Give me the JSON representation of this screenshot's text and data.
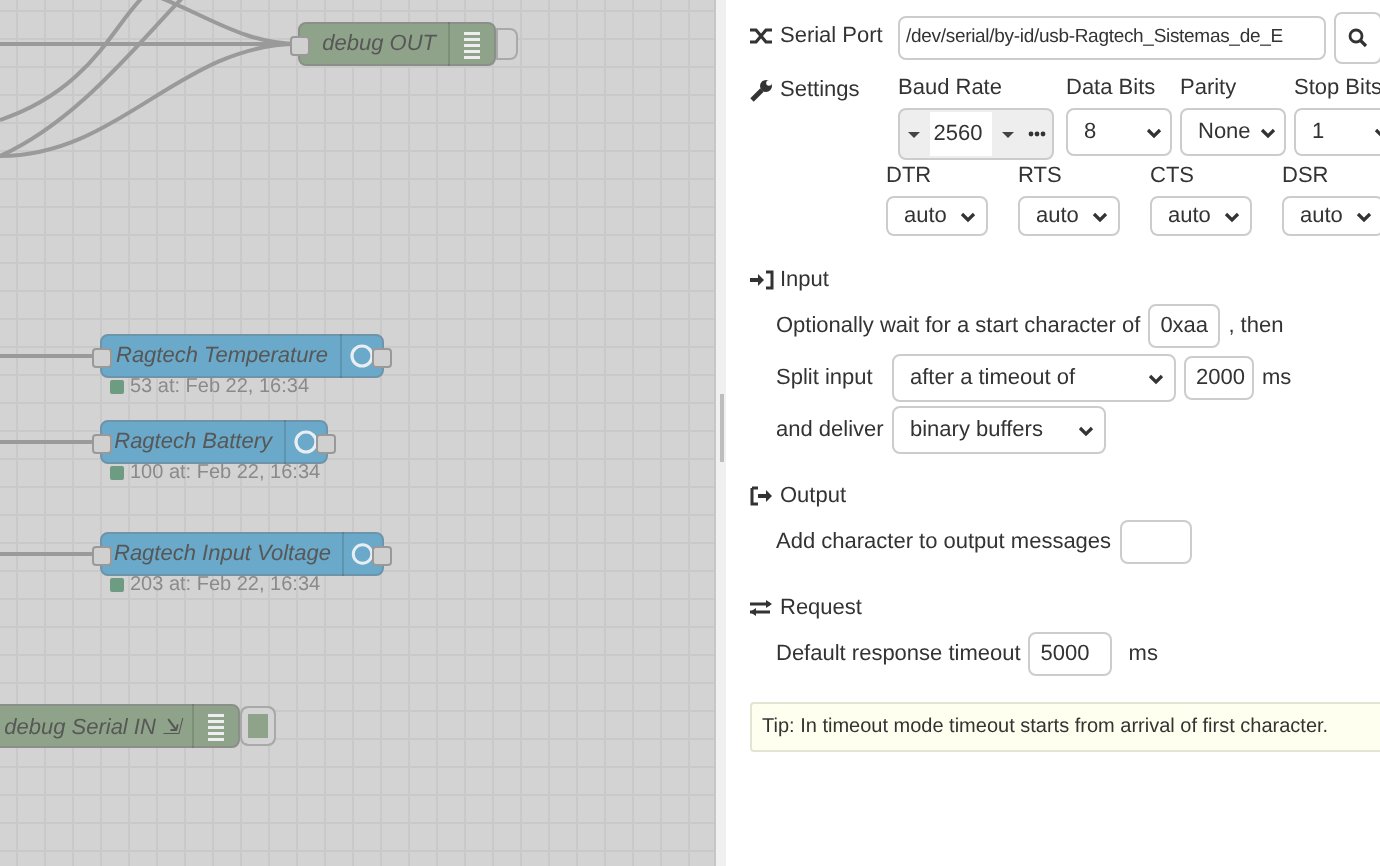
{
  "canvas": {
    "nodes": [
      {
        "kind": "debug",
        "label": "debug OUT",
        "active": false
      },
      {
        "kind": "function",
        "label": "Ragtech Temperature",
        "status": "53 at: Feb 22, 16:34"
      },
      {
        "kind": "function",
        "label": "Ragtech Battery",
        "status": "100 at: Feb 22, 16:34"
      },
      {
        "kind": "function",
        "label": "Ragtech Input Voltage",
        "status": "203 at: Feb 22, 16:34"
      },
      {
        "kind": "debug",
        "label": "debug Serial IN ⇲",
        "active": true
      }
    ]
  },
  "serial_port": {
    "label": "Serial Port",
    "value": "/dev/serial/by-id/usb-Ragtech_Sistemas_de_E"
  },
  "settings": {
    "label": "Settings",
    "baud_rate": {
      "label": "Baud Rate",
      "value": "2560"
    },
    "selects": [
      {
        "label": "Data Bits",
        "value": "8"
      },
      {
        "label": "Parity",
        "value": "None"
      },
      {
        "label": "Stop Bits",
        "value": "1"
      }
    ],
    "lines": [
      {
        "label": "DTR",
        "value": "auto"
      },
      {
        "label": "RTS",
        "value": "auto"
      },
      {
        "label": "CTS",
        "value": "auto"
      },
      {
        "label": "DSR",
        "value": "auto"
      }
    ]
  },
  "input": {
    "title": "Input",
    "start_prefix": "Optionally wait for a start character of",
    "start_char": "0xaa",
    "start_suffix": ", then",
    "split_label": "Split input",
    "split_mode": "after a timeout of",
    "split_value": "2000",
    "split_unit": "ms",
    "deliver_label": "and deliver",
    "deliver": "binary buffers"
  },
  "output": {
    "title": "Output",
    "label": "Add character to output messages"
  },
  "request": {
    "title": "Request",
    "label": "Default response timeout",
    "value": "5000",
    "unit": "ms"
  },
  "tip": "Tip: In timeout mode timeout starts from arrival of first character."
}
